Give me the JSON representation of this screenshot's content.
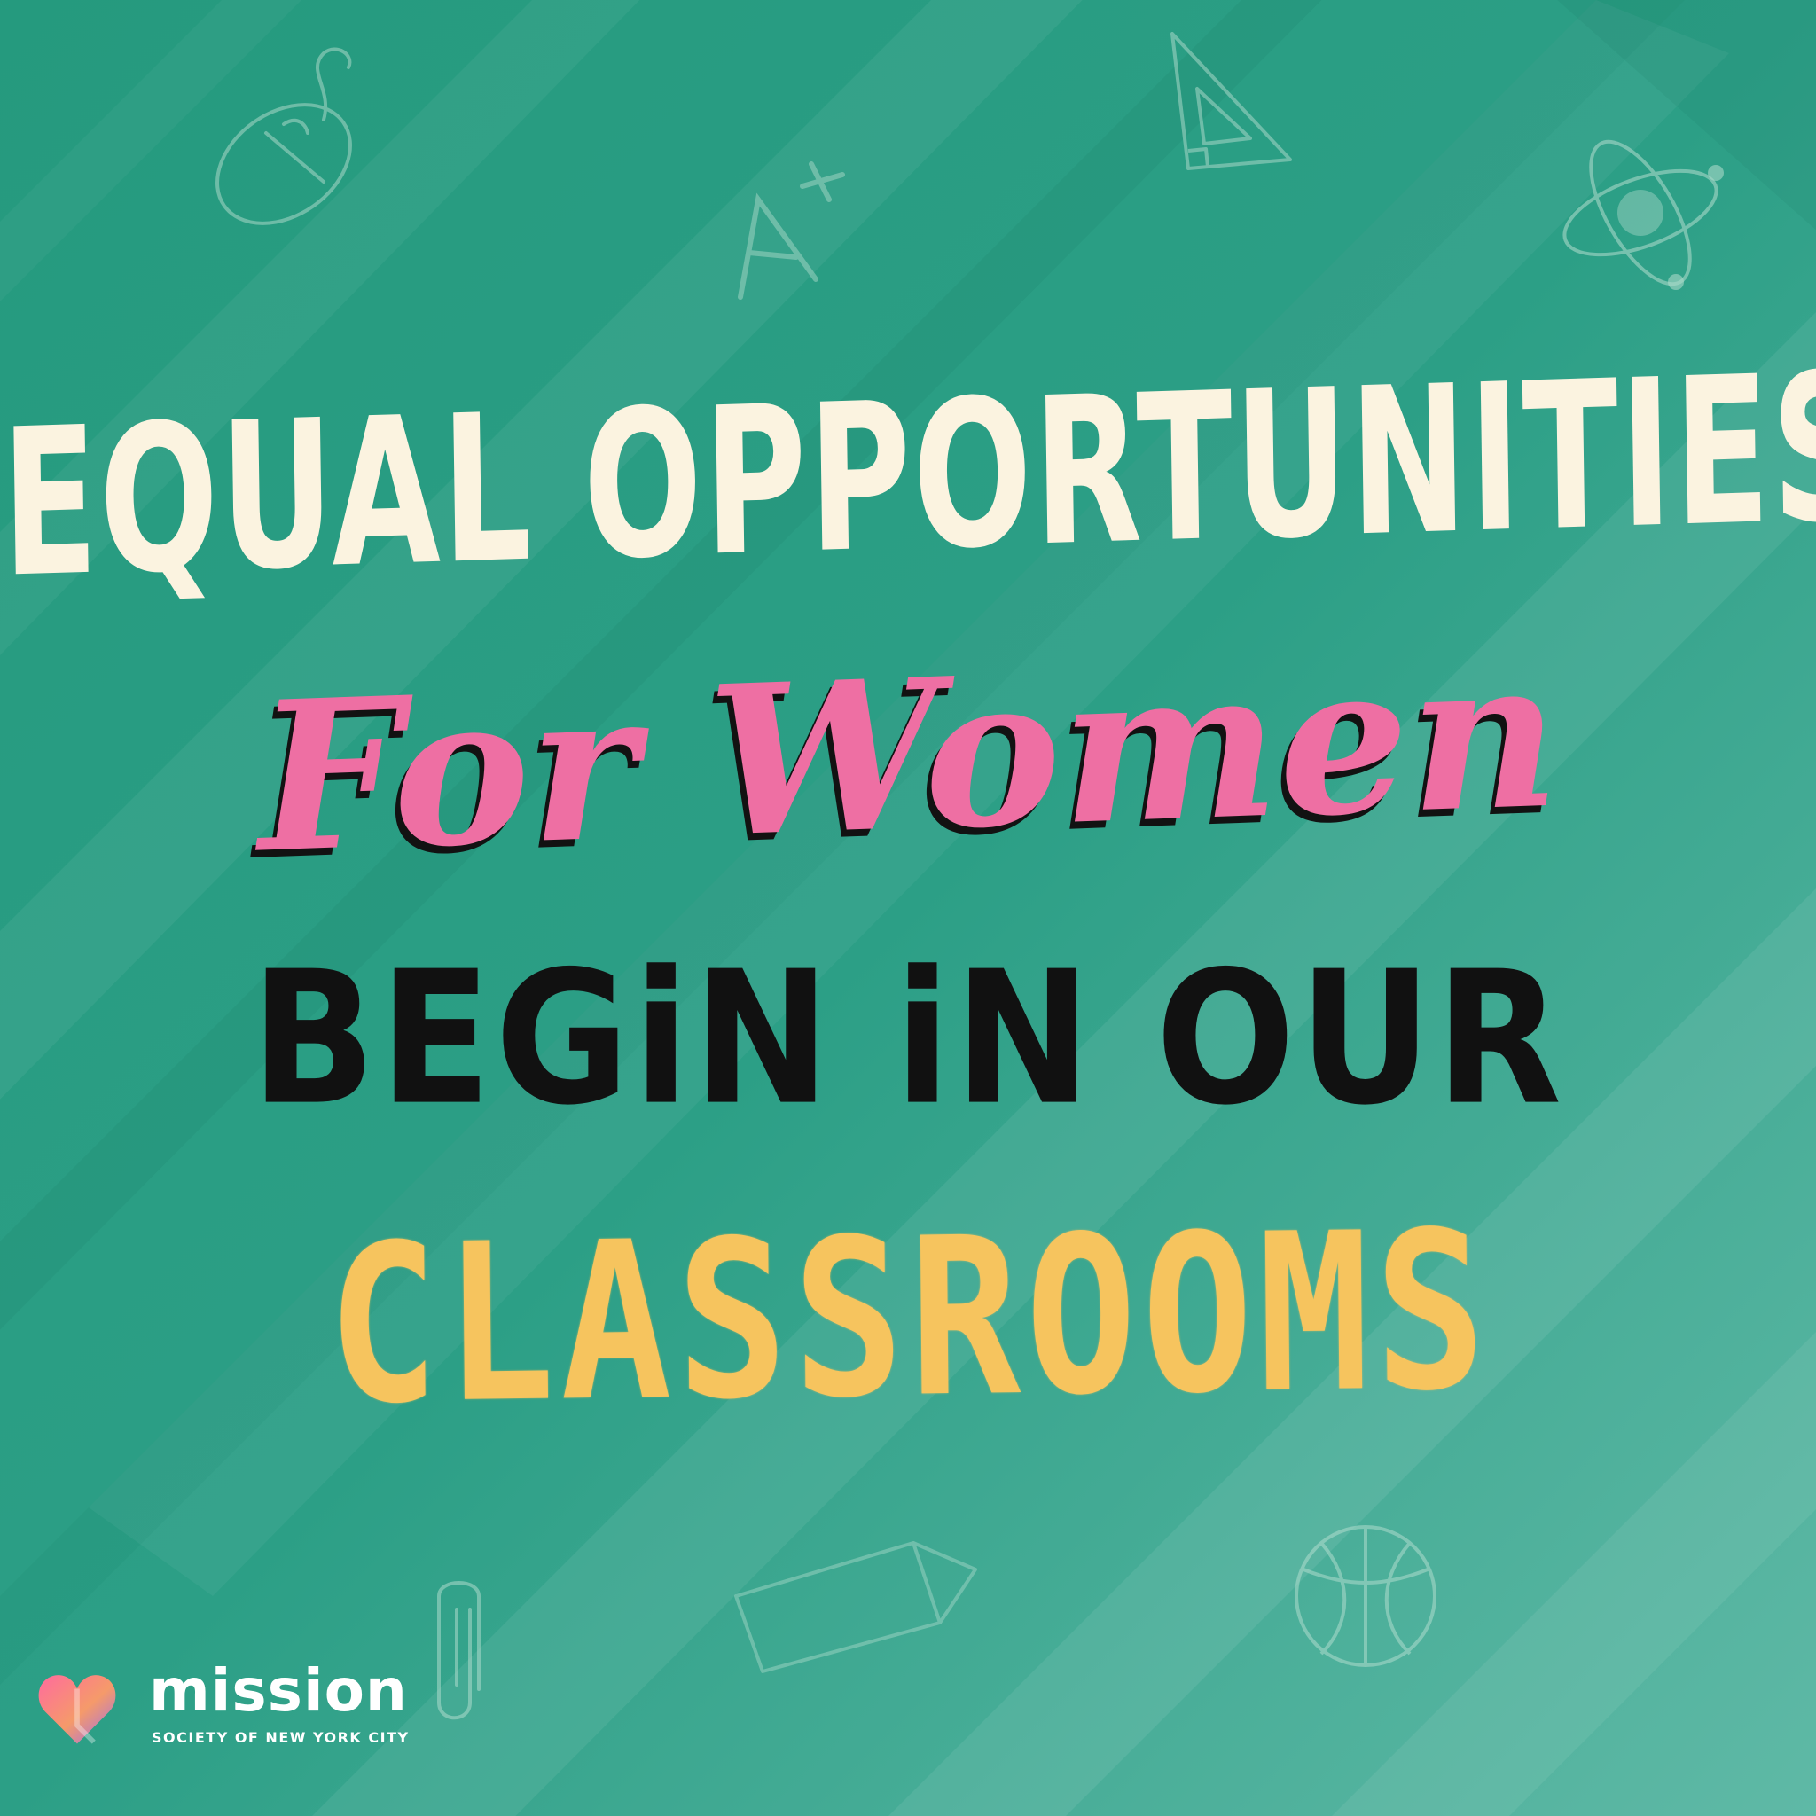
{
  "headline": {
    "line_1": "EQUAL OPPORTUNITIES",
    "line_2": "For Women",
    "line_3": "BEGiN iN OUR",
    "line_4": "CLASSROOMS"
  },
  "doodles": {
    "grade": "A+",
    "icons": [
      "computer-mouse-icon",
      "triangle-ruler-icon",
      "atom-icon",
      "basketball-icon",
      "paper-clip-icon",
      "pencil-icon"
    ]
  },
  "logo": {
    "name": "mission",
    "tagline": "SOCIETY OF NEW YORK CITY"
  },
  "colors": {
    "chalkboard": "#2a9a80",
    "cream": "#fbf3e0",
    "pink": "#ee6fa3",
    "black": "#111111",
    "chalk_yellow": "#f6c45e"
  }
}
